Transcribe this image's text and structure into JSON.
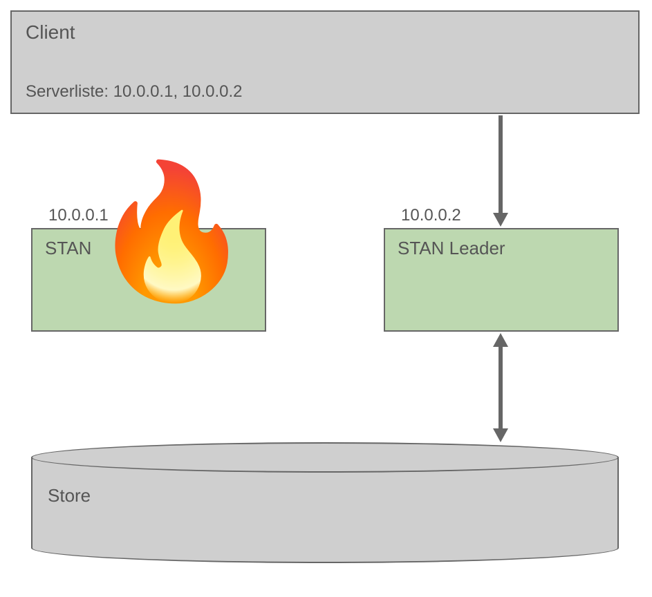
{
  "client": {
    "title": "Client",
    "serverlist": "Serverliste: 10.0.0.1, 10.0.0.2"
  },
  "node1": {
    "ip": "10.0.0.1",
    "label": "STAN",
    "state": "failed"
  },
  "node2": {
    "ip": "10.0.0.2",
    "label": "STAN Leader",
    "state": "leader"
  },
  "store": {
    "label": "Store"
  },
  "connections": [
    {
      "from": "client",
      "to": "node2",
      "type": "unidirectional"
    },
    {
      "from": "node2",
      "to": "store",
      "type": "bidirectional"
    }
  ]
}
